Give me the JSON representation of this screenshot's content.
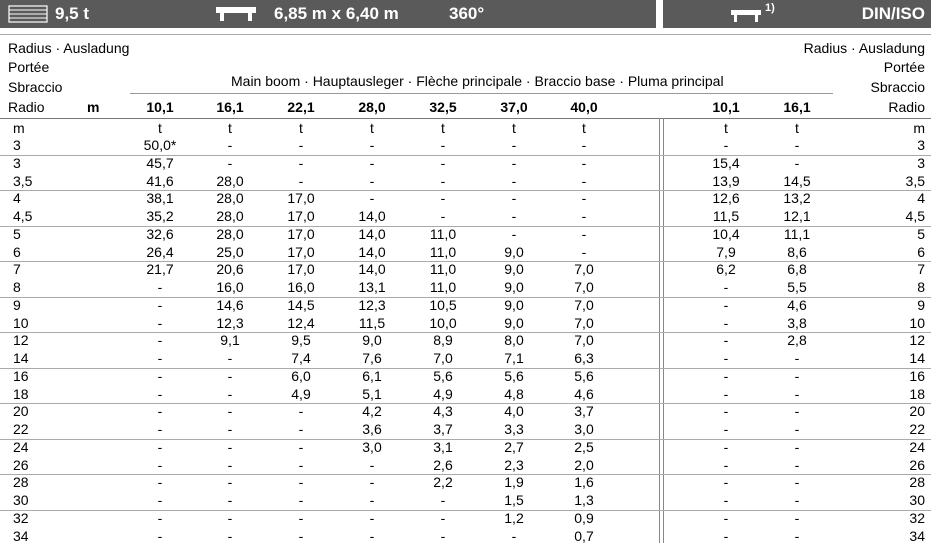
{
  "header": {
    "weight": "9,5 t",
    "outrigger": "6,85 m x 6,40 m",
    "rotation": "360°",
    "footnote": "1)",
    "standard": "DIN/ISO"
  },
  "labels": {
    "radius_lines": [
      "Radius · Ausladung",
      "Portée",
      "Sbraccio",
      "Radio"
    ],
    "radius_lines_right": [
      "Radius · Ausladung",
      "Portée",
      "Sbraccio",
      "Radio"
    ],
    "main_boom": "Main boom · Hauptausleger · Flèche principale · Braccio base · Pluma principal",
    "m_label": "m",
    "unit_m": "m",
    "unit_t": "t"
  },
  "main_boom_lengths": [
    "10,1",
    "16,1",
    "22,1",
    "28,0",
    "32,5",
    "37,0",
    "40,0"
  ],
  "aux_boom_lengths": [
    "10,1",
    "16,1"
  ],
  "rows": [
    {
      "r": "3",
      "main": [
        "50,0*",
        "-",
        "-",
        "-",
        "-",
        "-",
        "-"
      ],
      "aux": [
        "-",
        "-"
      ],
      "r2": "3"
    },
    {
      "r": "3",
      "main": [
        "45,7",
        "-",
        "-",
        "-",
        "-",
        "-",
        "-"
      ],
      "aux": [
        "15,4",
        "-"
      ],
      "r2": "3"
    },
    {
      "r": "3,5",
      "main": [
        "41,6",
        "28,0",
        "-",
        "-",
        "-",
        "-",
        "-"
      ],
      "aux": [
        "13,9",
        "14,5"
      ],
      "r2": "3,5"
    },
    {
      "r": "4",
      "main": [
        "38,1",
        "28,0",
        "17,0",
        "-",
        "-",
        "-",
        "-"
      ],
      "aux": [
        "12,6",
        "13,2"
      ],
      "r2": "4"
    },
    {
      "r": "4,5",
      "main": [
        "35,2",
        "28,0",
        "17,0",
        "14,0",
        "-",
        "-",
        "-"
      ],
      "aux": [
        "11,5",
        "12,1"
      ],
      "r2": "4,5"
    },
    {
      "r": "5",
      "main": [
        "32,6",
        "28,0",
        "17,0",
        "14,0",
        "11,0",
        "-",
        "-"
      ],
      "aux": [
        "10,4",
        "11,1"
      ],
      "r2": "5"
    },
    {
      "r": "6",
      "main": [
        "26,4",
        "25,0",
        "17,0",
        "14,0",
        "11,0",
        "9,0",
        "-"
      ],
      "aux": [
        "7,9",
        "8,6"
      ],
      "r2": "6"
    },
    {
      "r": "7",
      "main": [
        "21,7",
        "20,6",
        "17,0",
        "14,0",
        "11,0",
        "9,0",
        "7,0"
      ],
      "aux": [
        "6,2",
        "6,8"
      ],
      "r2": "7"
    },
    {
      "r": "8",
      "main": [
        "-",
        "16,0",
        "16,0",
        "13,1",
        "11,0",
        "9,0",
        "7,0"
      ],
      "aux": [
        "-",
        "5,5"
      ],
      "r2": "8"
    },
    {
      "r": "9",
      "main": [
        "-",
        "14,6",
        "14,5",
        "12,3",
        "10,5",
        "9,0",
        "7,0"
      ],
      "aux": [
        "-",
        "4,6"
      ],
      "r2": "9"
    },
    {
      "r": "10",
      "main": [
        "-",
        "12,3",
        "12,4",
        "11,5",
        "10,0",
        "9,0",
        "7,0"
      ],
      "aux": [
        "-",
        "3,8"
      ],
      "r2": "10"
    },
    {
      "r": "12",
      "main": [
        "-",
        "9,1",
        "9,5",
        "9,0",
        "8,9",
        "8,0",
        "7,0"
      ],
      "aux": [
        "-",
        "2,8"
      ],
      "r2": "12"
    },
    {
      "r": "14",
      "main": [
        "-",
        "-",
        "7,4",
        "7,6",
        "7,0",
        "7,1",
        "6,3"
      ],
      "aux": [
        "-",
        "-"
      ],
      "r2": "14"
    },
    {
      "r": "16",
      "main": [
        "-",
        "-",
        "6,0",
        "6,1",
        "5,6",
        "5,6",
        "5,6"
      ],
      "aux": [
        "-",
        "-"
      ],
      "r2": "16"
    },
    {
      "r": "18",
      "main": [
        "-",
        "-",
        "4,9",
        "5,1",
        "4,9",
        "4,8",
        "4,6"
      ],
      "aux": [
        "-",
        "-"
      ],
      "r2": "18"
    },
    {
      "r": "20",
      "main": [
        "-",
        "-",
        "-",
        "4,2",
        "4,3",
        "4,0",
        "3,7"
      ],
      "aux": [
        "-",
        "-"
      ],
      "r2": "20"
    },
    {
      "r": "22",
      "main": [
        "-",
        "-",
        "-",
        "3,6",
        "3,7",
        "3,3",
        "3,0"
      ],
      "aux": [
        "-",
        "-"
      ],
      "r2": "22"
    },
    {
      "r": "24",
      "main": [
        "-",
        "-",
        "-",
        "3,0",
        "3,1",
        "2,7",
        "2,5"
      ],
      "aux": [
        "-",
        "-"
      ],
      "r2": "24"
    },
    {
      "r": "26",
      "main": [
        "-",
        "-",
        "-",
        "-",
        "2,6",
        "2,3",
        "2,0"
      ],
      "aux": [
        "-",
        "-"
      ],
      "r2": "26"
    },
    {
      "r": "28",
      "main": [
        "-",
        "-",
        "-",
        "-",
        "2,2",
        "1,9",
        "1,6"
      ],
      "aux": [
        "-",
        "-"
      ],
      "r2": "28"
    },
    {
      "r": "30",
      "main": [
        "-",
        "-",
        "-",
        "-",
        "-",
        "1,5",
        "1,3"
      ],
      "aux": [
        "-",
        "-"
      ],
      "r2": "30"
    },
    {
      "r": "32",
      "main": [
        "-",
        "-",
        "-",
        "-",
        "-",
        "1,2",
        "0,9"
      ],
      "aux": [
        "-",
        "-"
      ],
      "r2": "32"
    },
    {
      "r": "34",
      "main": [
        "-",
        "-",
        "-",
        "-",
        "-",
        "-",
        "0,7"
      ],
      "aux": [
        "-",
        "-"
      ],
      "r2": "34"
    }
  ],
  "colors": {
    "header_bar": "#5a5a5a",
    "header_text": "#ffffff"
  }
}
